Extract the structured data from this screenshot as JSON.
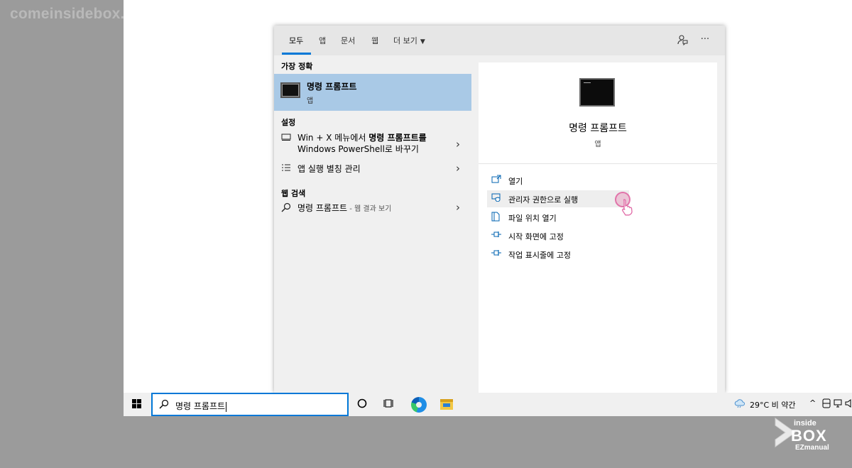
{
  "watermark": "comeinsidebox.com",
  "tabs": [
    {
      "label": "모두"
    },
    {
      "label": "앱"
    },
    {
      "label": "문서"
    },
    {
      "label": "웹"
    },
    {
      "label": "더 보기"
    }
  ],
  "header_icons": {
    "feedback": "feedback-icon",
    "more": "···"
  },
  "left": {
    "best_match_label": "가장 정확",
    "best_match": {
      "title": "명령 프롬프트",
      "subtitle": "앱"
    },
    "settings_label": "설정",
    "settings_items": [
      {
        "line1_prefix": "Win + X 메뉴에서 ",
        "line1_bold": "명령 프롬프트를",
        "line2": "Windows PowerShell로 바꾸기"
      },
      {
        "line1_prefix": "앱 실행 별칭 관리"
      }
    ],
    "web_label": "웹 검색",
    "web_item": {
      "query": "명령 프롬프트",
      "suffix": " - 웹 결과 보기"
    }
  },
  "right": {
    "title": "명령 프롬프트",
    "subtitle": "앱",
    "actions": [
      {
        "label": "열기",
        "icon": "open-icon"
      },
      {
        "label": "관리자 권한으로 실행",
        "icon": "shield-icon"
      },
      {
        "label": "파일 위치 열기",
        "icon": "file-location-icon"
      },
      {
        "label": "시작 화면에 고정",
        "icon": "pin-icon"
      },
      {
        "label": "작업 표시줄에 고정",
        "icon": "pin-icon"
      }
    ]
  },
  "taskbar": {
    "search_value": "명령 프롬프트",
    "weather": "29°C  비 약간",
    "tray_arrow": "^"
  },
  "logo": {
    "line1": "inside",
    "line2": "BOX",
    "line3": "EZmanual"
  }
}
